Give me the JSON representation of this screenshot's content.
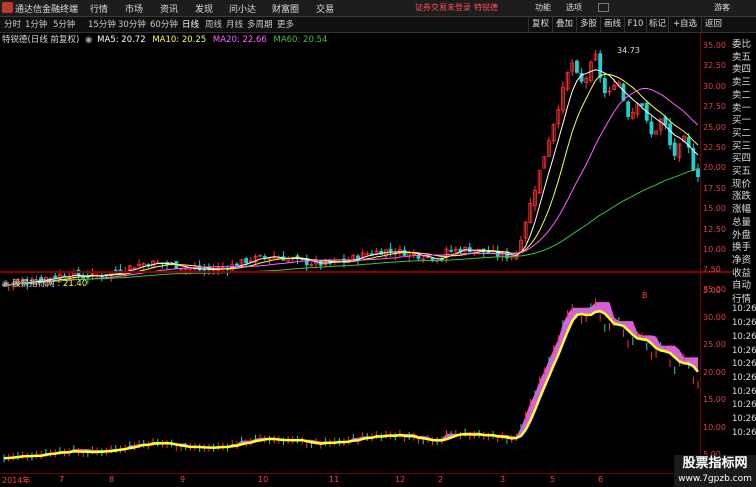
{
  "titlebar": {
    "app_title": "通达信金融终端",
    "menus": [
      "行情",
      "市场",
      "资讯",
      "发现",
      "问小达",
      "财富圈",
      "交易"
    ],
    "trade_status": "证券交易未登录",
    "account_name": "特锐德",
    "right_menus": [
      "功能",
      "选项",
      "游客"
    ]
  },
  "periods": [
    "分时",
    "1分钟",
    "5分钟",
    "15分钟",
    "30分钟",
    "60分钟",
    "日线",
    "周线",
    "月线",
    "多周期",
    "更多"
  ],
  "active_period": "日线",
  "toolbar": [
    "复权",
    "叠加",
    "多股",
    "画线",
    "F10",
    "标记",
    "+自选",
    "返回"
  ],
  "main_info": {
    "stock": "特锐德(日线 前复权)",
    "ma5": "MA5: 20.72",
    "ma10": "MA10: 20.25",
    "ma20": "MA20: 22.66",
    "ma60": "MA60: 20.54"
  },
  "main_yticks": [
    "35.00",
    "32.50",
    "30.00",
    "27.50",
    "25.00",
    "22.50",
    "20.00",
    "17.50",
    "15.00",
    "12.50",
    "10.00",
    "7.50",
    "5.00"
  ],
  "peak_label": "34.73",
  "sub_info": {
    "indicator": "股票指标网",
    "value": ": 21.40"
  },
  "sub_yticks": [
    "35.00",
    "30.00",
    "25.00",
    "20.00",
    "15.00",
    "10.00",
    "5.00"
  ],
  "marker_b": "B",
  "xlabels": [
    "2014年",
    "7",
    "8",
    "9",
    "10",
    "11",
    "12",
    "2",
    "3",
    "5",
    "6"
  ],
  "right_panel_top": [
    "委比",
    "卖五",
    "卖四",
    "卖三",
    "卖二",
    "卖一",
    "买一",
    "买二",
    "买三",
    "买四",
    "买五",
    "现价",
    "涨跌",
    "涨幅",
    "总量",
    "外盘",
    "换手",
    "净资",
    "收益"
  ],
  "right_panel_bottom": [
    "自动",
    "行情",
    "10:26",
    "10:26",
    "10:26",
    "10:26",
    "10:26",
    "10:26",
    "10:26",
    "10:26",
    "10:26",
    "10:26"
  ],
  "watermark": {
    "title": "股票指标网",
    "url": "www.7gpzb.com"
  },
  "colors": {
    "up": "#ff3030",
    "down": "#20d0d0",
    "ma5": "#ffffff",
    "ma10": "#ffff40",
    "ma20": "#ff60ff",
    "ma60": "#40c040",
    "indicator_line": "#ffff30",
    "indicator_fill": "#ff70ff",
    "axis": "#7a0000"
  }
}
